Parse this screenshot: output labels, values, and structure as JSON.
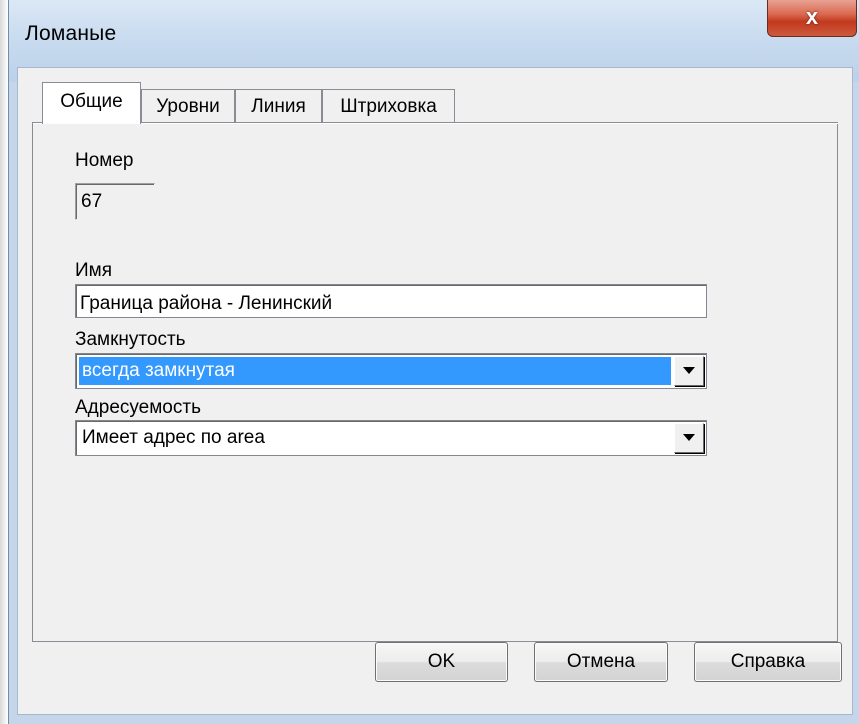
{
  "window": {
    "title": "Ломаные",
    "close_glyph": "x",
    "close_icon": "close-icon"
  },
  "tabs": [
    {
      "label": "Общие",
      "active": true
    },
    {
      "label": "Уровни",
      "active": false
    },
    {
      "label": "Линия",
      "active": false
    },
    {
      "label": "Штриховка",
      "active": false
    }
  ],
  "general": {
    "number_label": "Номер",
    "number_value": "67",
    "name_label": "Имя",
    "name_value": "Граница района - Ленинский",
    "closure_label": "Замкнутость",
    "closure_value": "всегда замкнутая",
    "address_label": "Адресуемость",
    "address_value": "Имеет адрес по area"
  },
  "buttons": {
    "ok": "OK",
    "cancel": "Отмена",
    "help": "Справка"
  },
  "colors": {
    "selection": "#3399ff",
    "close_button": "#c2391f"
  }
}
